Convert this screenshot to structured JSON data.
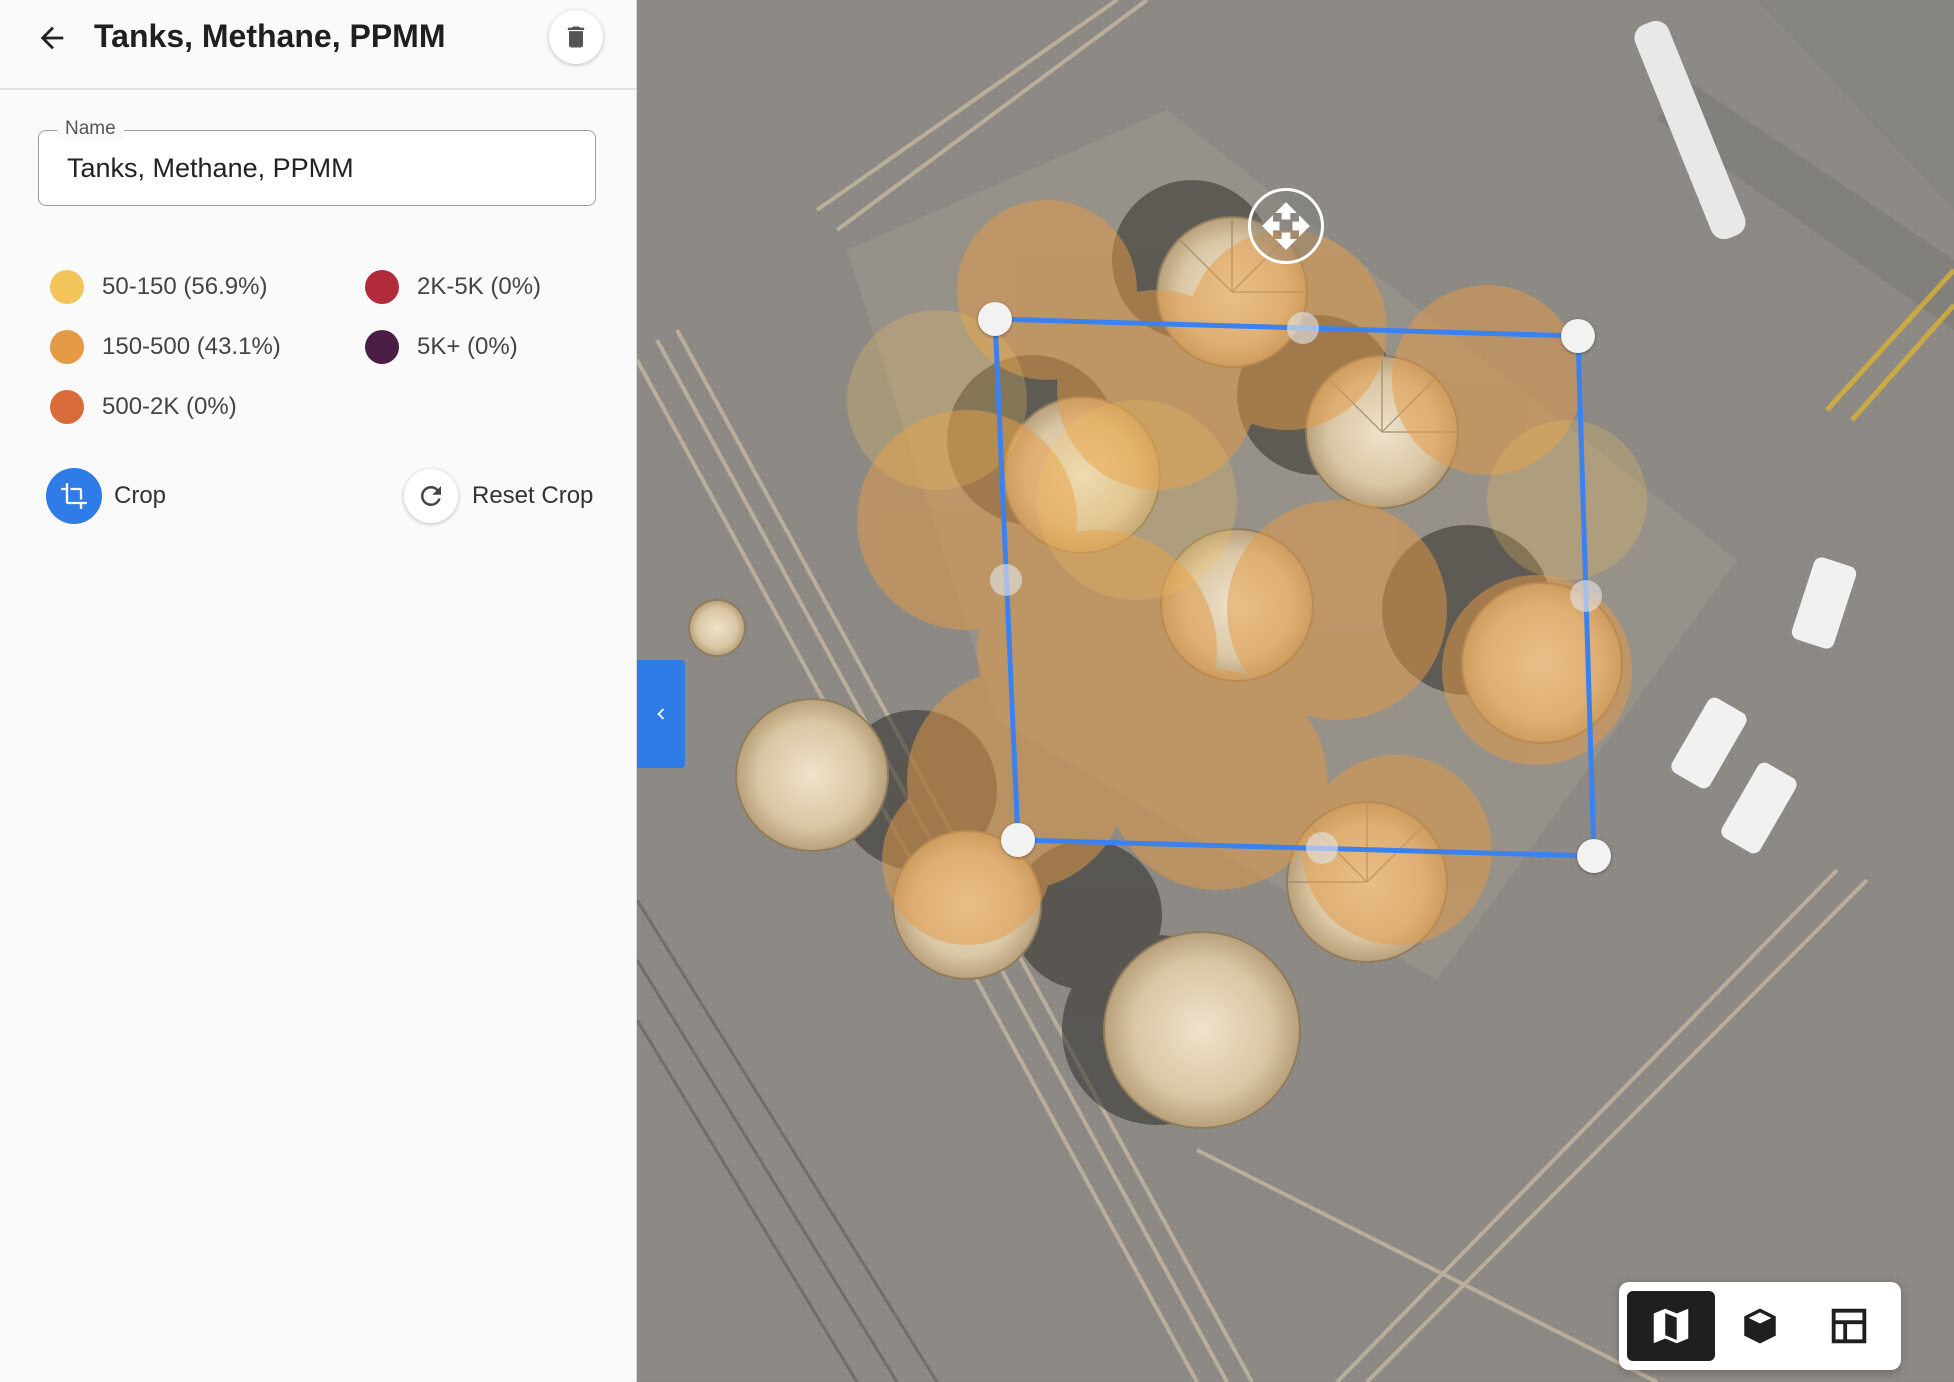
{
  "header": {
    "title": "Tanks, Methane, PPMM"
  },
  "name_field": {
    "label": "Name",
    "value": "Tanks, Methane, PPMM"
  },
  "legend": [
    {
      "label": "50-150 (56.9%)",
      "color": "#f2c45a"
    },
    {
      "label": "150-500 (43.1%)",
      "color": "#e59a45"
    },
    {
      "label": "500-2K (0%)",
      "color": "#d96b3a"
    },
    {
      "label": "2K-5K (0%)",
      "color": "#b22b3a"
    },
    {
      "label": "5K+ (0%)",
      "color": "#4a1e46"
    }
  ],
  "actions": {
    "crop_label": "Crop",
    "reset_crop_label": "Reset Crop"
  },
  "colors": {
    "accent": "#2f7be8",
    "crop_outline": "#3b82f0"
  },
  "icons": {
    "back": "arrow-left-icon",
    "delete": "trash-icon",
    "crop": "crop-icon",
    "reset": "refresh-icon",
    "collapse": "chevron-left-icon",
    "move": "move-arrows-icon",
    "map_view": "map-icon",
    "model_view": "cube-icon",
    "split_view": "layout-icon"
  }
}
